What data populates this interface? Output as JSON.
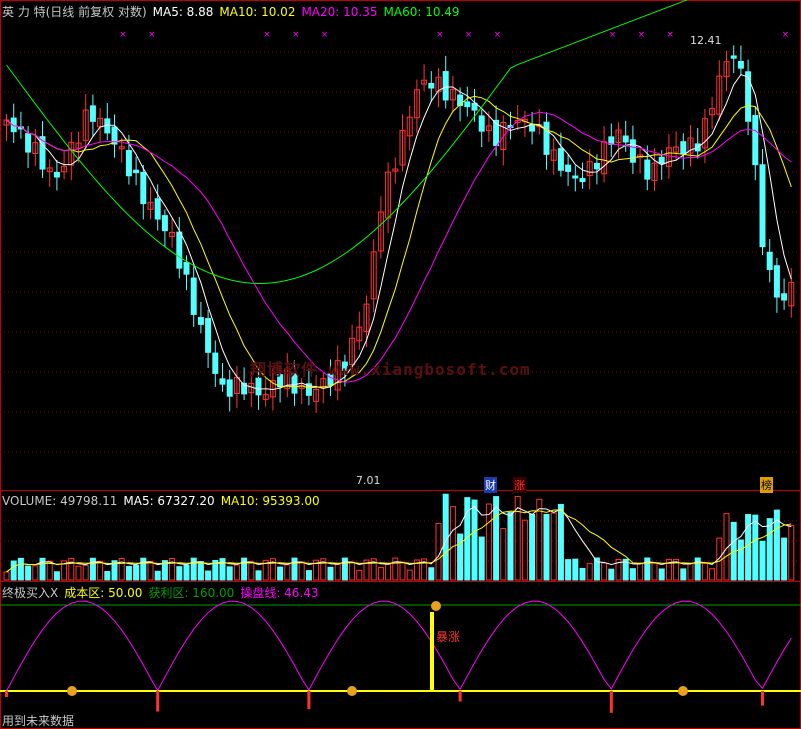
{
  "colors": {
    "up": "#ff3232",
    "down": "#54ffff",
    "ma5": "#ffffff",
    "ma10": "#ffff00",
    "ma20": "#ff00ff",
    "ma60": "#00ff00",
    "grid": "#8b0000",
    "border": "#c00000",
    "cost": "#ffff00",
    "profit": "#00a000",
    "line": "#ff00ff"
  },
  "price_header": {
    "title": "英 力 特(日线 前复权 对数)",
    "ma5": "MA5: 8.88",
    "ma10": "MA10: 10.02",
    "ma20": "MA20: 10.35",
    "ma60": "MA60: 10.49"
  },
  "volume_header": {
    "label": "VOLUME: 49798.11",
    "ma5": "MA5: 67327.20",
    "ma10": "MA10: 95393.00"
  },
  "indicator_header": {
    "name": "终极买入X",
    "cost": "成本区: 50.00",
    "profit": "获利区: 160.00",
    "line": "操盘线: 46.43"
  },
  "annotations": {
    "high": "12.41",
    "low": "7.01",
    "watermark": "翔博软件 www.xiangbosoft.com",
    "cai": "财",
    "zhang": "涨",
    "bang": "榜",
    "surge": "暴涨",
    "footer": "用到未来数据"
  },
  "chart_data": [
    {
      "type": "candlestick",
      "title": "英 力 特(日线 前复权 对数)",
      "series": [
        {
          "name": "MA5",
          "last": 8.88
        },
        {
          "name": "MA10",
          "last": 10.02
        },
        {
          "name": "MA20",
          "last": 10.35
        },
        {
          "name": "MA60",
          "last": 10.49
        }
      ],
      "high_label": 12.41,
      "low_label": 7.01
    },
    {
      "type": "bar",
      "title": "VOLUME",
      "series": [
        {
          "name": "VOLUME",
          "last": 49798.11
        },
        {
          "name": "MA5",
          "last": 67327.2
        },
        {
          "name": "MA10",
          "last": 95393.0
        }
      ]
    },
    {
      "type": "line",
      "title": "终极买入X",
      "series": [
        {
          "name": "成本区",
          "last": 50.0
        },
        {
          "name": "获利区",
          "last": 160.0
        },
        {
          "name": "操盘线",
          "last": 46.43
        }
      ]
    }
  ]
}
